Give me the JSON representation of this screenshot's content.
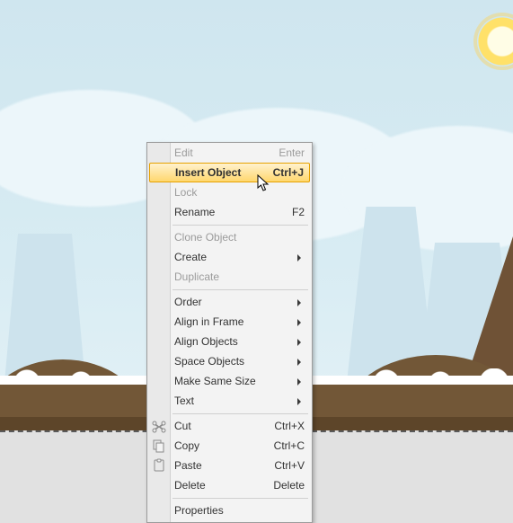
{
  "menu": {
    "edit": {
      "label": "Edit",
      "shortcut": "Enter"
    },
    "insert": {
      "label": "Insert Object",
      "shortcut": "Ctrl+J"
    },
    "lock": {
      "label": "Lock"
    },
    "rename": {
      "label": "Rename",
      "shortcut": "F2"
    },
    "clone": {
      "label": "Clone Object"
    },
    "create": {
      "label": "Create"
    },
    "duplicate": {
      "label": "Duplicate"
    },
    "order": {
      "label": "Order"
    },
    "alignFrame": {
      "label": "Align in Frame"
    },
    "alignObj": {
      "label": "Align Objects"
    },
    "spaceObj": {
      "label": "Space Objects"
    },
    "sameSize": {
      "label": "Make Same Size"
    },
    "text": {
      "label": "Text"
    },
    "cut": {
      "label": "Cut",
      "shortcut": "Ctrl+X"
    },
    "copy": {
      "label": "Copy",
      "shortcut": "Ctrl+C"
    },
    "paste": {
      "label": "Paste",
      "shortcut": "Ctrl+V"
    },
    "delete": {
      "label": "Delete",
      "shortcut": "Delete"
    },
    "properties": {
      "label": "Properties"
    }
  }
}
